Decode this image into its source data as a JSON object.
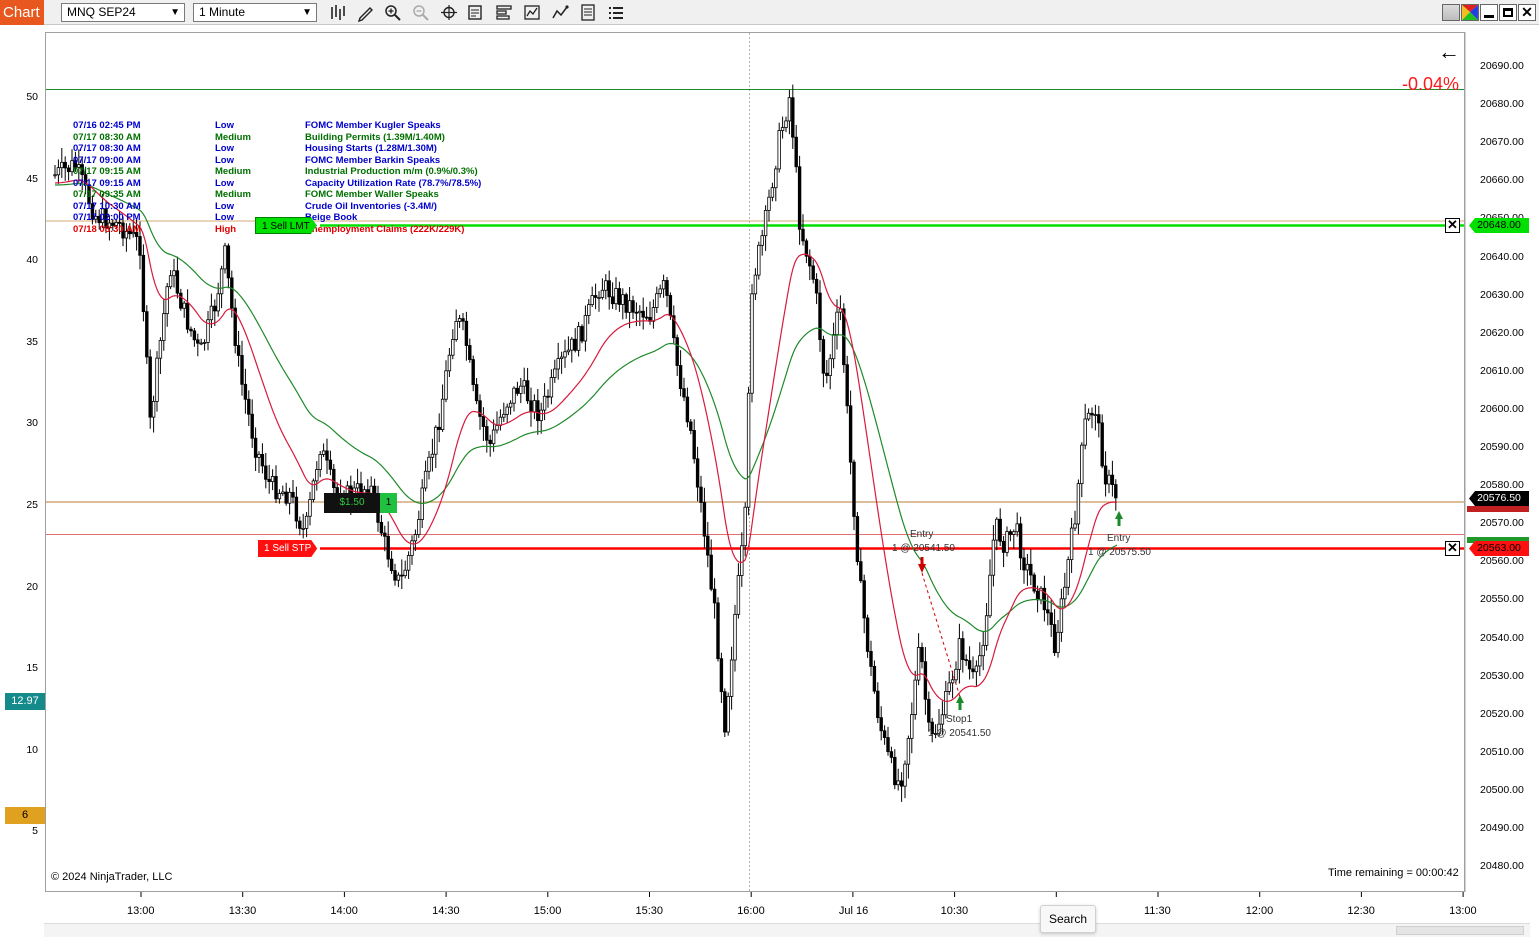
{
  "app": {
    "tab_label": "Chart"
  },
  "toolbar": {
    "instrument": "MNQ SEP24",
    "interval": "1 Minute",
    "icons": [
      "bars-type-icon",
      "pencil-icon",
      "zoom-in-icon",
      "zoom-out-icon",
      "crosshair-icon",
      "properties-icon",
      "templates-icon",
      "strategies-icon",
      "indicators-icon",
      "data-box-icon",
      "list-icon"
    ]
  },
  "window": {
    "icons": [
      "color-picker-icon",
      "minimize-icon",
      "maximize-icon",
      "close-icon"
    ]
  },
  "colors": {
    "accent": "#e8571e",
    "bull": "#00c000",
    "bear": "#e00000",
    "ema_fast": "#d81b3c",
    "ema_slow": "#1f8a2a",
    "last_price_line": "#c8a060",
    "event_low": "#0000cc",
    "event_medium": "#007000",
    "event_high": "#e00000"
  },
  "chart": {
    "change_pct": "-0.04%",
    "back_arrow": "←",
    "copyright": "© 2024 NinjaTrader, LLC",
    "time_remaining": "Time remaining = 00:00:42",
    "price_axis": [
      "20690.00",
      "20680.00",
      "20670.00",
      "20660.00",
      "20650.00",
      "20640.00",
      "20630.00",
      "20620.00",
      "20610.00",
      "20600.00",
      "20590.00",
      "20580.00",
      "20570.00",
      "20560.00",
      "20550.00",
      "20540.00",
      "20530.00",
      "20520.00",
      "20510.00",
      "20500.00",
      "20490.00",
      "20480.00"
    ],
    "left_axis": [
      "50",
      "45",
      "40",
      "35",
      "30",
      "25",
      "20",
      "15",
      "10",
      "5"
    ],
    "time_axis": [
      "13:00",
      "13:30",
      "14:00",
      "14:30",
      "15:00",
      "15:30",
      "16:00",
      "Jul 16",
      "10:30",
      "11:00",
      "11:30",
      "12:00",
      "12:30",
      "13:00"
    ],
    "price_tags": {
      "sell_limit": "20648.00",
      "last": "20576.50",
      "sell_stop": "20563.00"
    },
    "left_tags": {
      "teal": "12.97",
      "gold": "6"
    },
    "orders": {
      "sell_limit": "1   Sell LMT",
      "sell_stop": "1   Sell STP",
      "pnl": "$1.50",
      "qty": "1"
    },
    "trades": [
      {
        "label1": "Entry",
        "label2": "1 @ 20541.50"
      },
      {
        "label1": "Stop1",
        "label2": "1 @ 20541.50"
      },
      {
        "label1": "Entry",
        "label2": "1 @ 20575.50"
      }
    ],
    "events": [
      {
        "time": "07/16 02:45 PM",
        "impact": "Low",
        "name": "FOMC Member Kugler Speaks"
      },
      {
        "time": "07/17 08:30 AM",
        "impact": "Medium",
        "name": "Building Permits (1.39M/1.40M)"
      },
      {
        "time": "07/17 08:30 AM",
        "impact": "Low",
        "name": "Housing Starts (1.28M/1.30M)"
      },
      {
        "time": "07/17 09:00 AM",
        "impact": "Low",
        "name": "FOMC Member Barkin Speaks"
      },
      {
        "time": "07/17 09:15 AM",
        "impact": "Medium",
        "name": "Industrial Production m/m (0.9%/0.3%)"
      },
      {
        "time": "07/17 09:15 AM",
        "impact": "Low",
        "name": "Capacity Utilization Rate (78.7%/78.5%)"
      },
      {
        "time": "07/17 09:35 AM",
        "impact": "Medium",
        "name": "FOMC Member Waller Speaks"
      },
      {
        "time": "07/17 10:30 AM",
        "impact": "Low",
        "name": "Crude Oil Inventories (-3.4M/)"
      },
      {
        "time": "07/17 02:00 PM",
        "impact": "Low",
        "name": "Beige Book"
      },
      {
        "time": "07/18 08:30 AM",
        "impact": "High",
        "name": "Unemployment Claims (222K/229K)"
      }
    ]
  },
  "tooltip": {
    "search": "Search"
  }
}
